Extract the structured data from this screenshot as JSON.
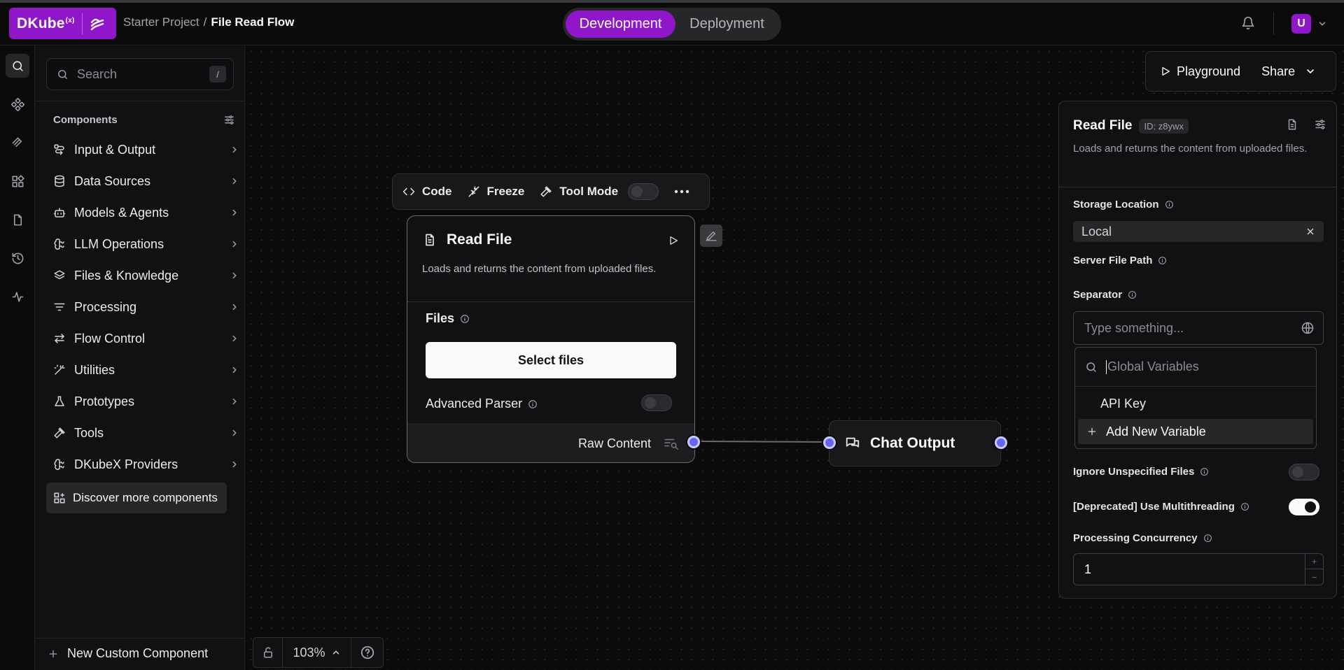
{
  "app": {
    "brand": "DKube",
    "brand_sup": "(x)",
    "breadcrumb": {
      "project": "Starter Project",
      "separator": "/",
      "flow": "File Read Flow"
    },
    "modes": {
      "active": "Development",
      "inactive": "Deployment"
    },
    "user_initial": "U",
    "accent_color": "#8f16c9",
    "handle_color": "#6366f1"
  },
  "sidebar": {
    "search_placeholder": "Search",
    "search_shortcut": "/",
    "section_title": "Components",
    "categories": [
      {
        "label": "Input & Output",
        "icon": "input-output-icon"
      },
      {
        "label": "Data Sources",
        "icon": "database-icon"
      },
      {
        "label": "Models & Agents",
        "icon": "bot-icon"
      },
      {
        "label": "LLM Operations",
        "icon": "brain-icon"
      },
      {
        "label": "Files & Knowledge",
        "icon": "layers-icon"
      },
      {
        "label": "Processing",
        "icon": "filter-icon"
      },
      {
        "label": "Flow Control",
        "icon": "arrows-icon"
      },
      {
        "label": "Utilities",
        "icon": "wand-icon"
      },
      {
        "label": "Prototypes",
        "icon": "flask-icon"
      },
      {
        "label": "Tools",
        "icon": "hammer-icon"
      },
      {
        "label": "DKubeX Providers",
        "icon": "brain-icon"
      }
    ],
    "discover_label": "Discover more components",
    "new_component_label": "New Custom Component"
  },
  "node_toolbar": {
    "code_label": "Code",
    "freeze_label": "Freeze",
    "tool_mode_label": "Tool Mode",
    "tool_mode_on": false
  },
  "read_file_node": {
    "title": "Read File",
    "description": "Loads and returns the content from uploaded files.",
    "files_label": "Files",
    "select_files_label": "Select files",
    "advanced_parser_label": "Advanced Parser",
    "advanced_parser_on": false,
    "output_label": "Raw Content"
  },
  "chat_output_node": {
    "title": "Chat Output"
  },
  "canvas_controls": {
    "zoom": "103%"
  },
  "top_actions": {
    "playground_label": "Playground",
    "share_label": "Share"
  },
  "inspector": {
    "title": "Read File",
    "id_badge": "ID: z8ywx",
    "description": "Loads and returns the content from uploaded files.",
    "storage_location_label": "Storage Location",
    "storage_location_value": "Local",
    "server_file_path_label": "Server File Path",
    "separator_label": "Separator",
    "separator_placeholder": "Type something...",
    "ignore_unspecified_label": "Ignore Unspecified Files",
    "ignore_unspecified_on": false,
    "multithreading_label": "[Deprecated] Use Multithreading",
    "multithreading_on": true,
    "concurrency_label": "Processing Concurrency",
    "concurrency_value": "1"
  },
  "global_variables_popover": {
    "search_placeholder": "Global Variables",
    "items": [
      "API Key"
    ],
    "add_label": "Add New Variable"
  }
}
